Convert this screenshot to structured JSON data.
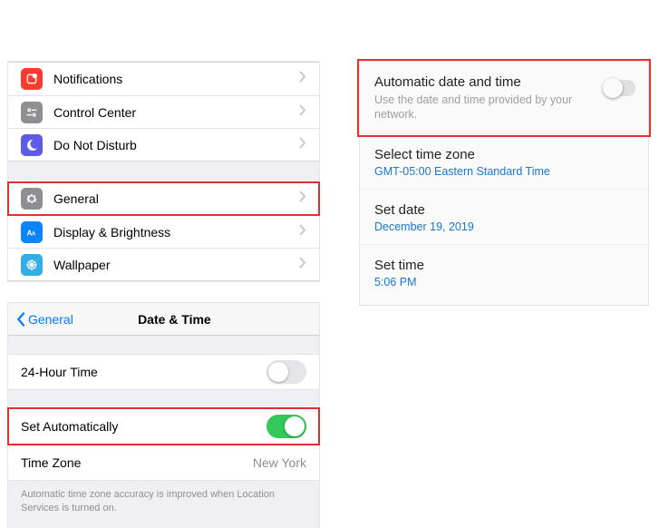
{
  "ios_settings": {
    "group1": [
      {
        "label": "Notifications"
      },
      {
        "label": "Control Center"
      },
      {
        "label": "Do Not Disturb"
      }
    ],
    "group2": [
      {
        "label": "General"
      },
      {
        "label": "Display & Brightness"
      },
      {
        "label": "Wallpaper"
      }
    ]
  },
  "ios_datetime": {
    "back_label": "General",
    "title": "Date & Time",
    "row_24h": "24-Hour Time",
    "row_auto": "Set Automatically",
    "row_tz_label": "Time Zone",
    "row_tz_value": "New York",
    "footer": "Automatic time zone accuracy is improved when Location Services is turned on."
  },
  "android": {
    "auto_title": "Automatic date and time",
    "auto_sub": "Use the date and time provided by your network.",
    "tz_title": "Select time zone",
    "tz_value": "GMT-05:00 Eastern Standard Time",
    "date_title": "Set date",
    "date_value": "December 19, 2019",
    "time_title": "Set time",
    "time_value": "5:06 PM"
  }
}
